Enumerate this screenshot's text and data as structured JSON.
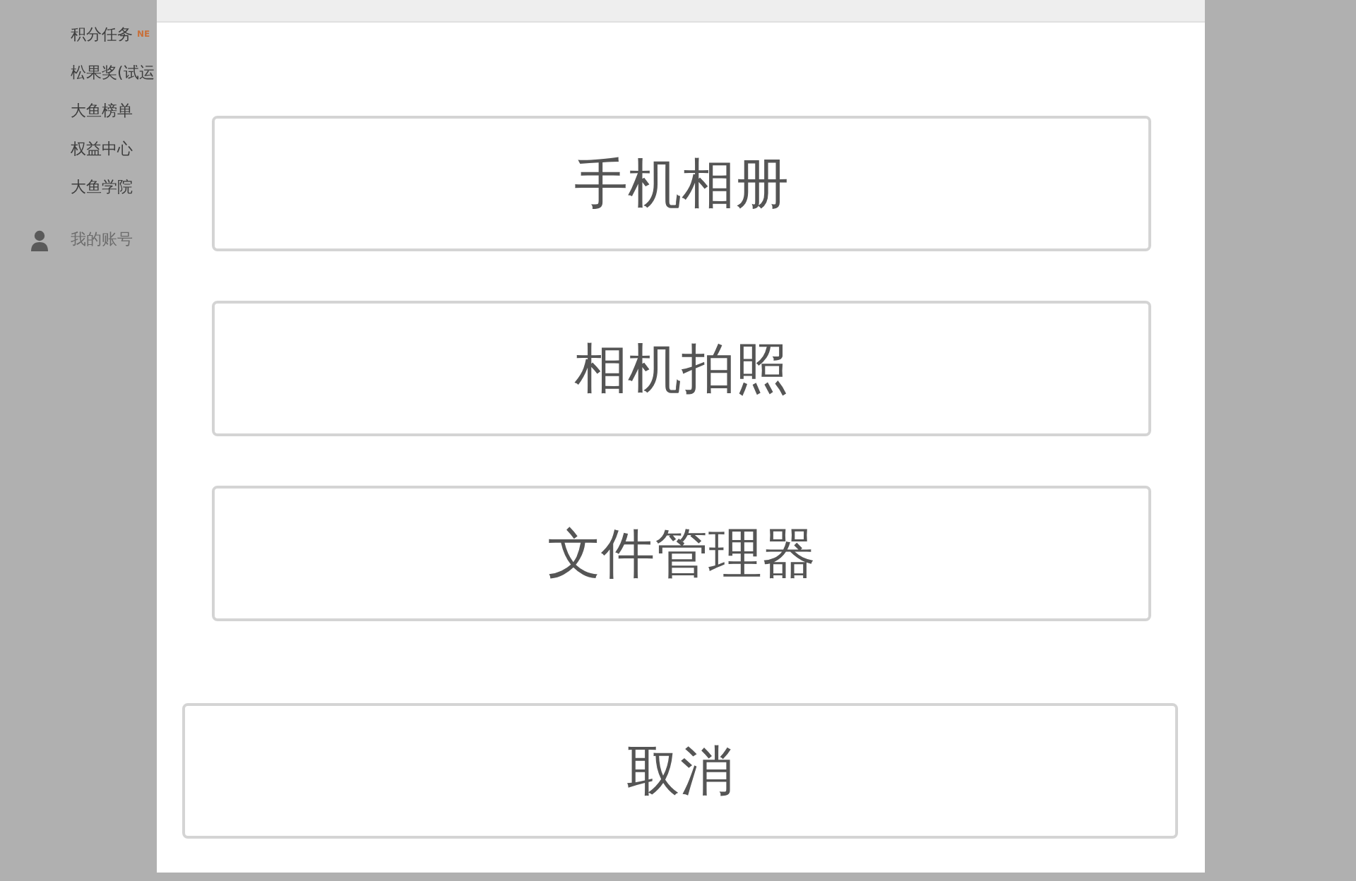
{
  "sidebar": {
    "items": [
      {
        "label": "积分任务",
        "badge": "NE"
      },
      {
        "label": "松果奖(试运"
      },
      {
        "label": "大鱼榜单"
      },
      {
        "label": "权益中心"
      },
      {
        "label": "大鱼学院"
      }
    ],
    "account": {
      "label": "我的账号"
    }
  },
  "dialog": {
    "options": [
      "手机相册",
      "相机拍照",
      "文件管理器"
    ],
    "cancel": "取消"
  }
}
